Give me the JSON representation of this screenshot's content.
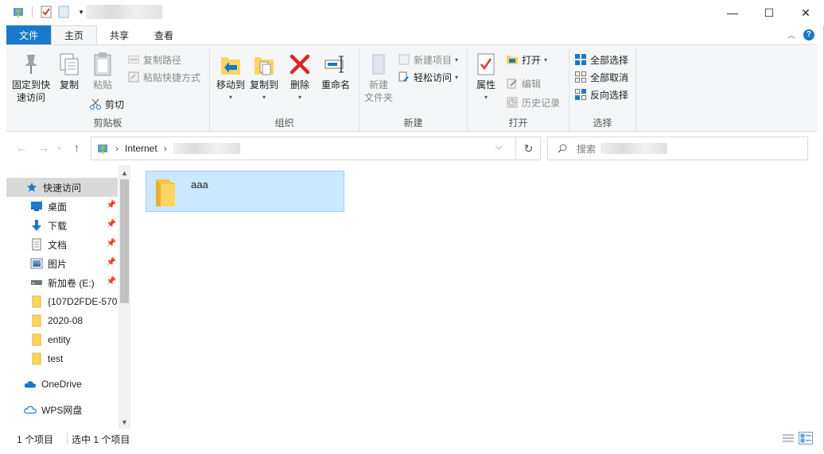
{
  "window": {
    "controls": {
      "minimize": "—",
      "maximize": "☐",
      "close": "✕"
    }
  },
  "tabs": [
    {
      "label": "文件"
    },
    {
      "label": "主页"
    },
    {
      "label": "共享"
    },
    {
      "label": "查看"
    }
  ],
  "ribbon": {
    "clipboard": {
      "label": "剪贴板",
      "pin_quick_access": "固定到快\n速访问",
      "pin_line1": "固定到快",
      "pin_line2": "速访问",
      "copy": "复制",
      "paste": "粘贴",
      "copy_path": "复制路径",
      "paste_shortcut": "粘贴快捷方式",
      "cut": "剪切"
    },
    "organize": {
      "label": "组织",
      "move_to": "移动到",
      "copy_to": "复制到",
      "delete": "删除",
      "rename": "重命名"
    },
    "new": {
      "label": "新建",
      "new_folder_line1": "新建",
      "new_folder_line2": "文件夹",
      "new_item": "新建项目",
      "easy_access": "轻松访问"
    },
    "open": {
      "label": "打开",
      "properties": "属性",
      "open": "打开",
      "edit": "编辑",
      "history": "历史记录"
    },
    "select": {
      "label": "选择",
      "select_all": "全部选择",
      "select_none": "全部取消",
      "invert": "反向选择"
    }
  },
  "address": {
    "path_root": "Internet",
    "separator": "›"
  },
  "search": {
    "placeholder": "搜索"
  },
  "navpane": {
    "items": [
      {
        "label": "快速访问",
        "icon": "star-icon"
      },
      {
        "label": "桌面",
        "icon": "desktop-icon"
      },
      {
        "label": "下载",
        "icon": "download-icon"
      },
      {
        "label": "文档",
        "icon": "document-icon"
      },
      {
        "label": "图片",
        "icon": "pictures-icon"
      },
      {
        "label": "新加卷 (E:)",
        "icon": "drive-icon"
      },
      {
        "label": "{107D2FDE-570",
        "icon": "folder-icon"
      },
      {
        "label": "2020-08",
        "icon": "folder-icon"
      },
      {
        "label": "entity",
        "icon": "folder-icon"
      },
      {
        "label": "test",
        "icon": "folder-icon"
      },
      {
        "label": "OneDrive",
        "icon": "cloud-icon"
      },
      {
        "label": "WPS网盘",
        "icon": "cloud-outline-icon"
      }
    ]
  },
  "content": {
    "items": [
      {
        "name": "aaa",
        "type": "folder",
        "selected": true
      }
    ]
  },
  "status": {
    "count": "1 个项目",
    "selected": "选中 1 个项目"
  },
  "colors": {
    "accent": "#1979ca",
    "selection": "#cce8ff",
    "folder": "#ffd55e"
  }
}
